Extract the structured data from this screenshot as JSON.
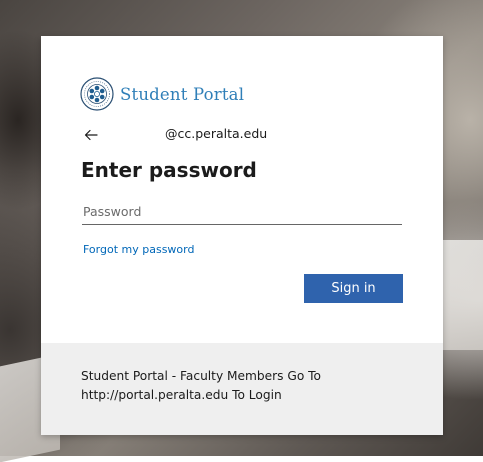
{
  "brand": {
    "name": "Student Portal",
    "logo_icon": "college-seal-icon",
    "accent_color": "#2f7fb8"
  },
  "identity": {
    "back_icon": "arrow-left-icon",
    "account": "@cc.peralta.edu"
  },
  "login": {
    "title": "Enter password",
    "password_placeholder": "Password",
    "password_value": "",
    "forgot_link": "Forgot my password",
    "signin_label": "Sign in",
    "button_color": "#2f63ad"
  },
  "footer": {
    "line1": "Student Portal - Faculty Members Go To",
    "line2": "http://portal.peralta.edu To Login"
  }
}
